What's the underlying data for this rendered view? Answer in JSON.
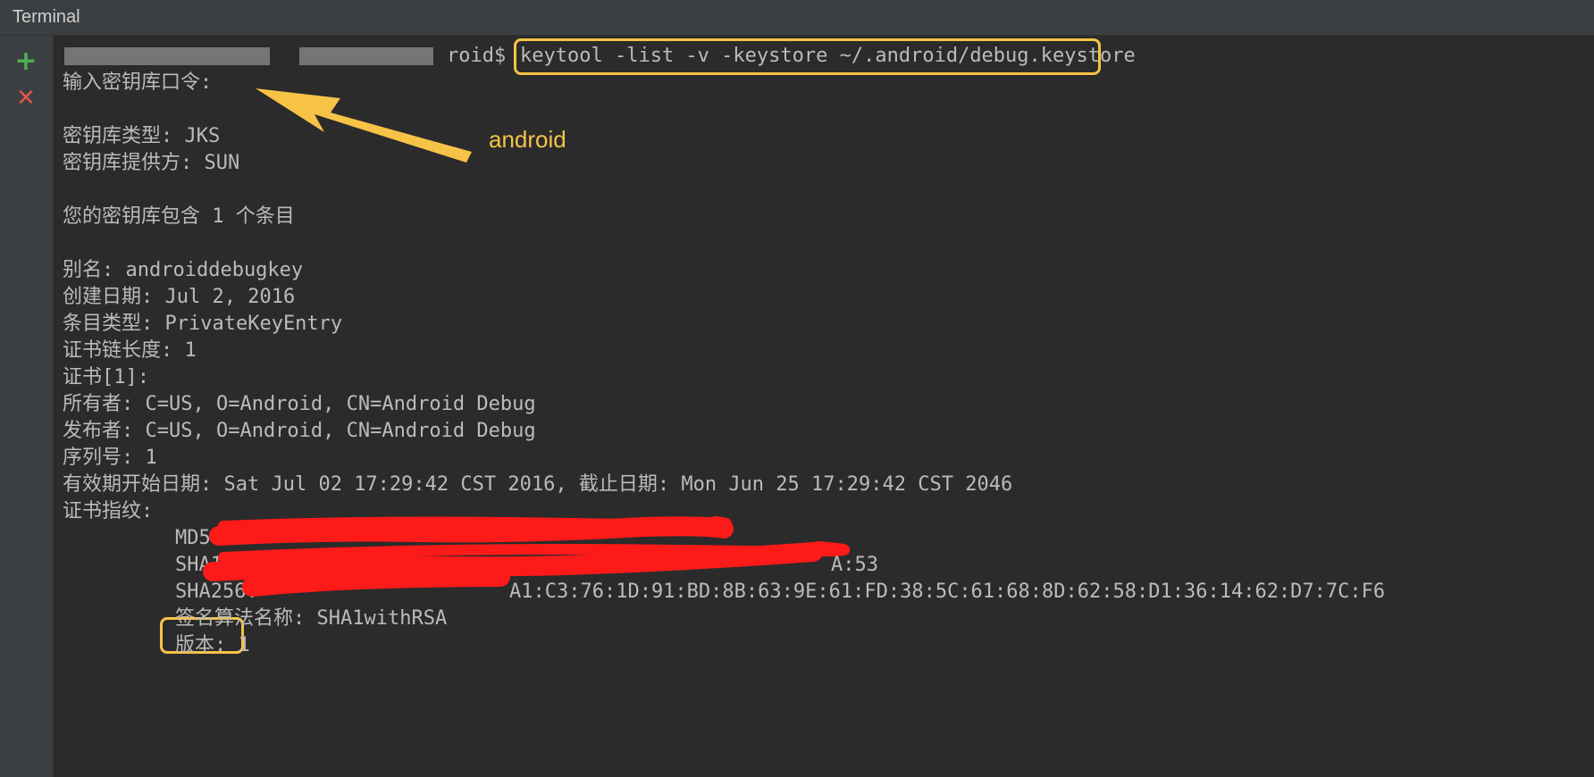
{
  "window": {
    "title": "Terminal"
  },
  "sidebar": {
    "new_session_icon": "plus-icon",
    "close_session_icon": "close-icon",
    "new_session_glyph": "+",
    "close_session_glyph": "✕"
  },
  "terminal": {
    "prompt_suffix": "roid$",
    "prompt_redacted_segments": 2,
    "command": "keytool -list -v -keystore ~/.android/debug.keystore",
    "lines": [
      "输入密钥库口令:",
      "",
      "密钥库类型: JKS",
      "密钥库提供方: SUN",
      "",
      "您的密钥库包含 1 个条目",
      "",
      "别名: androiddebugkey",
      "创建日期: Jul 2, 2016",
      "条目类型: PrivateKeyEntry",
      "证书链长度: 1",
      "证书[1]:",
      "所有者: C=US, O=Android, CN=Android Debug",
      "发布者: C=US, O=Android, CN=Android Debug",
      "序列号: 1",
      "有效期开始日期: Sat Jul 02 17:29:42 CST 2016, 截止日期: Mon Jun 25 17:29:42 CST 2046",
      "证书指纹:"
    ],
    "fingerprints": {
      "md5_label": "MD5:",
      "md5_value": "",
      "sha1_label": "SHA1:",
      "sha1_value_visible": "A:53",
      "sha256_label": "SHA256:",
      "sha256_value_visible": "A1:C3:76:1D:91:BD:8B:63:9E:61:FD:38:5C:61:68:8D:62:58:D1:36:14:62:D7:7C:F6"
    },
    "tail_lines": [
      "签名算法名称: SHA1withRSA",
      "版本: 1"
    ]
  },
  "annotations": {
    "arrow_label": "android",
    "highlight_color": "#f7c346",
    "redaction_color": "#ff1a1a"
  }
}
